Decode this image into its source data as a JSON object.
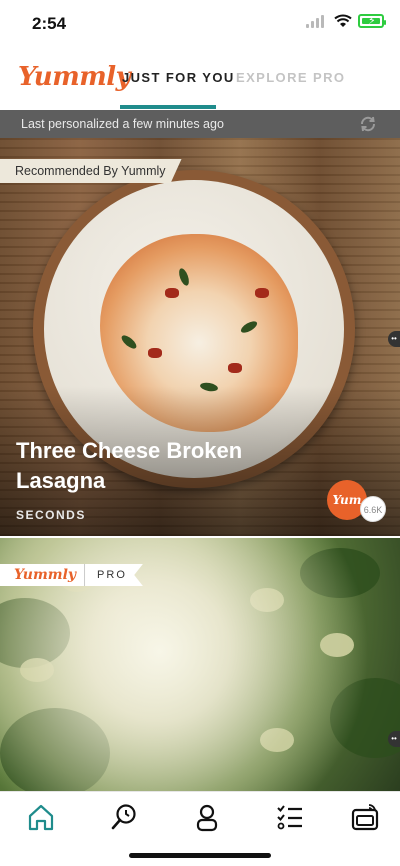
{
  "status_bar": {
    "time": "2:54"
  },
  "header": {
    "logo": "Yummly",
    "tabs": [
      {
        "label": "JUST FOR YOU",
        "active": true
      },
      {
        "label": "EXPLORE",
        "active": false
      },
      {
        "label": "PRO",
        "active": false
      }
    ]
  },
  "personalized_bar": {
    "text": "Last personalized a few minutes ago",
    "icon": "refresh-icon"
  },
  "cards": [
    {
      "badge": "Recommended By Yummly",
      "title": "Three Cheese Broken Lasagna",
      "source": "SECONDS",
      "yum_label": "Yum",
      "yum_count": "6.6K"
    },
    {
      "badge_logo": "Yummly",
      "badge_label": "PRO"
    }
  ],
  "bottom_nav": [
    {
      "name": "home",
      "icon": "home-icon",
      "active": true
    },
    {
      "name": "search",
      "icon": "search-icon",
      "active": false
    },
    {
      "name": "profile",
      "icon": "profile-icon",
      "active": false
    },
    {
      "name": "shopping-list",
      "icon": "checklist-icon",
      "active": false
    },
    {
      "name": "smart-oven",
      "icon": "oven-icon",
      "active": false
    }
  ],
  "colors": {
    "brand": "#e8622a",
    "tab_active_underline": "#1f8c8c",
    "nav_active": "#1f8c8c"
  }
}
